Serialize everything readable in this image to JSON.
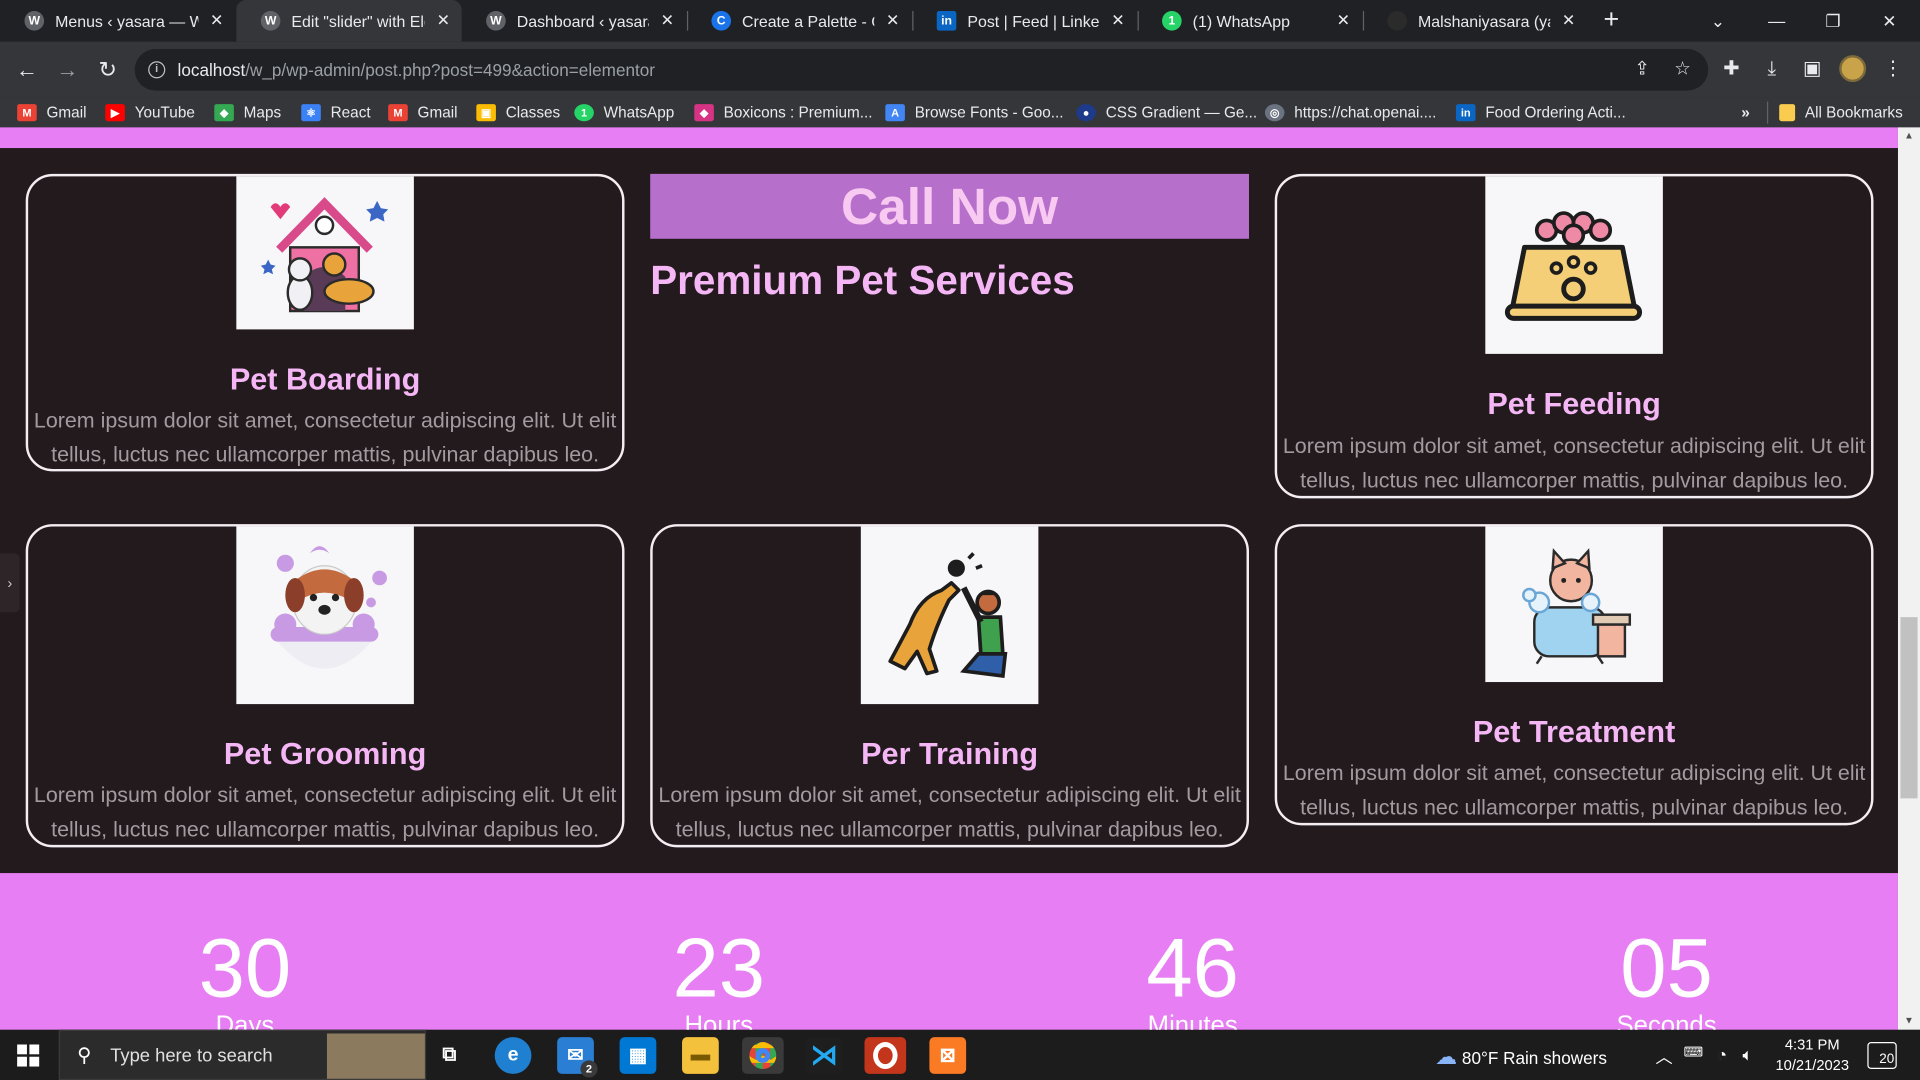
{
  "browser": {
    "tabs": [
      {
        "title": "Menus ‹ yasara — W",
        "fav_color": "#5f6368",
        "fav_glyph": ""
      },
      {
        "title": "Edit \"slider\" with Elem",
        "fav_color": "#5f6368",
        "fav_glyph": "",
        "active": true
      },
      {
        "title": "Dashboard ‹ yasara –",
        "fav_color": "#5f6368",
        "fav_glyph": ""
      },
      {
        "title": "Create a Palette - Coo",
        "fav_color": "#1a73e8",
        "fav_glyph": "C"
      },
      {
        "title": "Post | Feed | LinkedIn",
        "fav_color": "#0a66c2",
        "fav_glyph": "in"
      },
      {
        "title": "(1) WhatsApp",
        "fav_color": "#25d366",
        "fav_glyph": "1"
      },
      {
        "title": "Malshaniyasara (yasar",
        "fav_color": "#2b2b2b",
        "fav_glyph": ""
      }
    ],
    "url_host": "localhost",
    "url_path": "/w_p/wp-admin/post.php?post=499&action=elementor",
    "bookmarks": [
      {
        "label": "Gmail",
        "color": "#ea4335",
        "glyph": "M"
      },
      {
        "label": "YouTube",
        "color": "#ff0000",
        "glyph": "▶"
      },
      {
        "label": "Maps",
        "color": "#34a853",
        "glyph": "◆"
      },
      {
        "label": "React",
        "color": "#3b82f6",
        "glyph": "⚛"
      },
      {
        "label": "Gmail",
        "color": "#ea4335",
        "glyph": "M"
      },
      {
        "label": "Classes",
        "color": "#fbbc04",
        "glyph": "▣"
      },
      {
        "label": "WhatsApp",
        "color": "#25d366",
        "glyph": "1"
      },
      {
        "label": "Boxicons : Premium...",
        "color": "#d63384",
        "glyph": "◆"
      },
      {
        "label": "Browse Fonts - Goo...",
        "color": "#4285f4",
        "glyph": "A"
      },
      {
        "label": "CSS Gradient — Ge...",
        "color": "#1e3a8a",
        "glyph": "●"
      },
      {
        "label": "https://chat.openai....",
        "color": "#6b7280",
        "glyph": "◎"
      },
      {
        "label": "Food Ordering Acti...",
        "color": "#0a66c2",
        "glyph": "in"
      }
    ],
    "overflow_label": "»",
    "all_bookmarks": "All Bookmarks"
  },
  "page": {
    "call_now": "Call Now",
    "premium_heading": "Premium Pet Services",
    "cards": [
      {
        "title": "Pet Boarding",
        "desc": "Lorem ipsum dolor sit amet, consectetur adipiscing elit. Ut elit tellus, luctus nec ullamcorper mattis, pulvinar dapibus leo.",
        "icon": "pet-house-icon"
      },
      {
        "title": "Pet Feeding",
        "desc": "Lorem ipsum dolor sit amet, consectetur adipiscing elit. Ut elit tellus, luctus nec ullamcorper mattis, pulvinar dapibus leo.",
        "icon": "pet-food-bowl-icon"
      },
      {
        "title": "Pet Grooming",
        "desc": "Lorem ipsum dolor sit amet, consectetur adipiscing elit. Ut elit tellus, luctus nec ullamcorper mattis, pulvinar dapibus leo.",
        "icon": "dog-bath-icon"
      },
      {
        "title": "Per Training",
        "desc": "Lorem ipsum dolor sit amet, consectetur adipiscing elit. Ut elit tellus, luctus nec ullamcorper mattis, pulvinar dapibus leo.",
        "icon": "dog-training-icon"
      },
      {
        "title": "Pet Treatment",
        "desc": "Lorem ipsum dolor sit amet, consectetur adipiscing elit. Ut elit tellus, luctus nec ullamcorper mattis, pulvinar dapibus leo.",
        "icon": "cat-bathtub-icon"
      }
    ],
    "countdown": [
      {
        "value": "30",
        "label": "Days"
      },
      {
        "value": "23",
        "label": "Hours"
      },
      {
        "value": "46",
        "label": "Minutes"
      },
      {
        "value": "05",
        "label": "Seconds"
      }
    ],
    "colors": {
      "accent_pink": "#e77ef4",
      "heading_pink": "#f4b6f4",
      "bg": "#231a1d",
      "callnow_bg": "#b76fcc"
    }
  },
  "taskbar": {
    "search_placeholder": "Type here to search",
    "mail_badge": "2",
    "weather": "80°F  Rain showers",
    "time": "4:31 PM",
    "date": "10/21/2023",
    "notifications": "20"
  }
}
